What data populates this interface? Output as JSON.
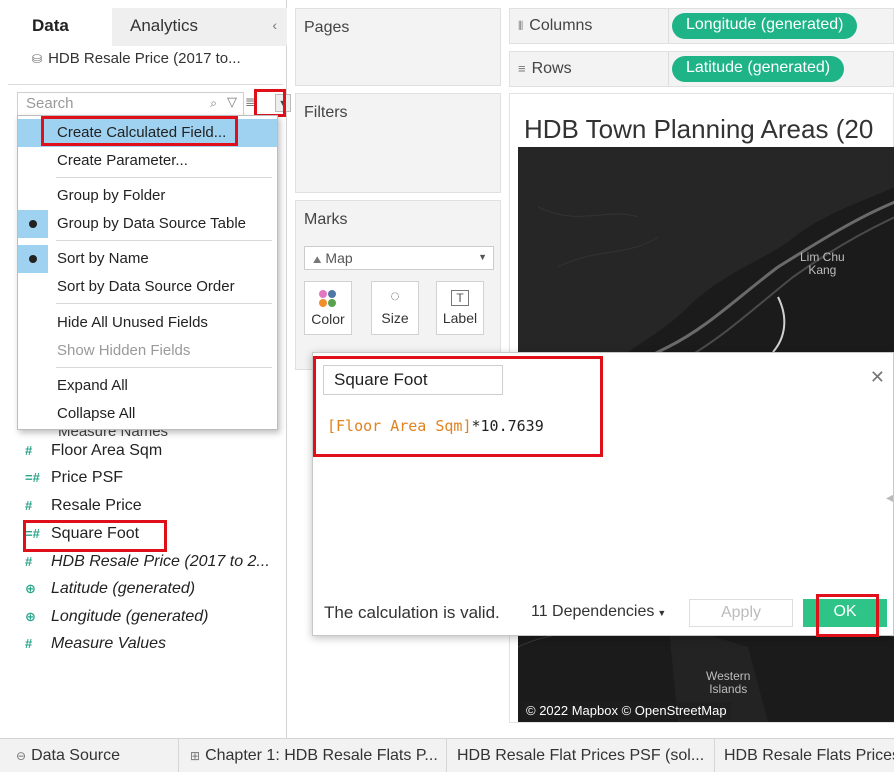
{
  "left_panel": {
    "tab_data": "Data",
    "tab_analytics": "Analytics",
    "collapse_glyph": "‹",
    "data_source": "HDB Resale Price (2017 to...",
    "search_placeholder": "Search"
  },
  "context_menu": {
    "items": [
      {
        "label": "Create Calculated Field...",
        "highlighted": true
      },
      {
        "label": "Create Parameter..."
      },
      {
        "label": "Group by Folder"
      },
      {
        "label": "Group by Data Source Table",
        "checked": true
      },
      {
        "label": "Sort by Name",
        "checked": true
      },
      {
        "label": "Sort by Data Source Order"
      },
      {
        "label": "Hide All Unused Fields"
      },
      {
        "label": "Show Hidden Fields",
        "disabled": true
      },
      {
        "label": "Expand All"
      },
      {
        "label": "Collapse All"
      }
    ],
    "partially_hidden_item": "Measure Names"
  },
  "fields": [
    {
      "label": "Floor Area Sqm",
      "icon": "#"
    },
    {
      "label": "Price PSF",
      "icon": "=#"
    },
    {
      "label": "Resale Price",
      "icon": "#"
    },
    {
      "label": "Square Foot",
      "icon": "=#"
    },
    {
      "label": "HDB Resale Price (2017 to 2...",
      "icon": "#",
      "italic": true
    },
    {
      "label": "Latitude (generated)",
      "icon": "globe",
      "italic": true
    },
    {
      "label": "Longitude (generated)",
      "icon": "globe",
      "italic": true
    },
    {
      "label": "Measure Values",
      "icon": "#",
      "italic": true
    }
  ],
  "shelves": {
    "pages": "Pages",
    "filters": "Filters",
    "marks": "Marks",
    "mark_type": "Map",
    "mark_buttons": [
      "Color",
      "Size",
      "Label"
    ],
    "columns_label": "Columns",
    "columns_pill": "Longitude (generated)",
    "rows_label": "Rows",
    "rows_pill": "Latitude (generated)"
  },
  "view": {
    "title": "HDB Town Planning Areas (20",
    "map_label_1": "Lim Chu\nKang",
    "map_label_2": "Western\nIslands",
    "map_credit": "© 2022 Mapbox © OpenStreetMap"
  },
  "calc_dialog": {
    "name": "Square Foot",
    "formula_field": "[Floor Area Sqm]",
    "formula_rest": "*10.7639",
    "status": "The calculation is valid.",
    "dependencies": "11 Dependencies",
    "apply": "Apply",
    "ok": "OK"
  },
  "bottom_tabs": [
    {
      "label": "Data Source",
      "icon": "⊖"
    },
    {
      "label": "Chapter 1: HDB Resale Flats P...",
      "icon": "⊞"
    },
    {
      "label": "HDB Resale Flat Prices PSF (sol...",
      "icon": ""
    },
    {
      "label": "HDB Resale Flats Prices",
      "icon": ""
    }
  ],
  "colors": {
    "pill_green": "#1fb487",
    "ok_green": "#2ec487",
    "highlight_blue": "#9fd1f0",
    "annotation_red": "#e0101a",
    "formula_field_orange": "#e0821f"
  }
}
